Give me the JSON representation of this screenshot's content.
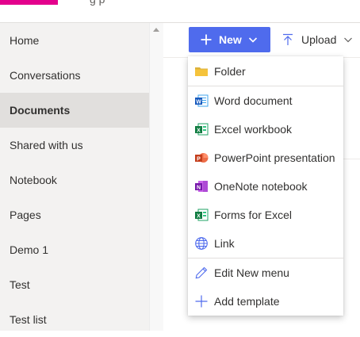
{
  "theme": {
    "brand": "#e3008c",
    "accent": "#4f6bed",
    "sidebar_bg": "#f3f2f1"
  },
  "header": {
    "site_name_fragment": "g p"
  },
  "sidebar": {
    "items": [
      {
        "label": "Home"
      },
      {
        "label": "Conversations"
      },
      {
        "label": "Documents",
        "active": true
      },
      {
        "label": "Shared with us"
      },
      {
        "label": "Notebook"
      },
      {
        "label": "Pages"
      },
      {
        "label": "Demo 1"
      },
      {
        "label": "Test"
      },
      {
        "label": "Test list"
      }
    ]
  },
  "toolbar": {
    "new_label": "New",
    "upload_label": "Upload"
  },
  "new_menu": {
    "items": [
      {
        "label": "Folder",
        "icon": "folder-icon"
      },
      {
        "label": "Word document",
        "icon": "word-icon"
      },
      {
        "label": "Excel workbook",
        "icon": "excel-icon"
      },
      {
        "label": "PowerPoint presentation",
        "icon": "powerpoint-icon"
      },
      {
        "label": "OneNote notebook",
        "icon": "onenote-icon"
      },
      {
        "label": "Forms for Excel",
        "icon": "forms-excel-icon"
      },
      {
        "label": "Link",
        "icon": "globe-icon"
      },
      {
        "label": "Edit New menu",
        "icon": "pencil-icon"
      },
      {
        "label": "Add template",
        "icon": "plus-icon"
      }
    ]
  }
}
